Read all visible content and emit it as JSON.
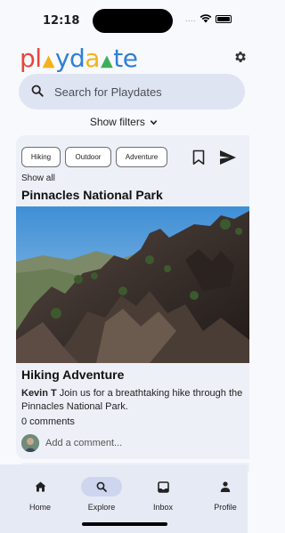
{
  "status": {
    "time": "12:18",
    "signal": "...."
  },
  "app": {
    "logo_letters": [
      {
        "char": "p",
        "color": "#e8453c"
      },
      {
        "char": "l",
        "color": "#e8453c"
      },
      {
        "char": "▲",
        "color": "#f2b21b"
      },
      {
        "char": "y",
        "color": "#2f7fd8"
      },
      {
        "char": "d",
        "color": "#2f7fd8"
      },
      {
        "char": "a",
        "color": "#f2b21b"
      },
      {
        "char": "▲",
        "color": "#3fae5a"
      },
      {
        "char": "t",
        "color": "#2f7fd8"
      },
      {
        "char": "e",
        "color": "#2f7fd8"
      }
    ],
    "settings_icon": "gear-icon"
  },
  "search": {
    "placeholder": "Search for Playdates"
  },
  "filters": {
    "label": "Show filters"
  },
  "post": {
    "tags": [
      "Hiking",
      "Outdoor",
      "Adventure"
    ],
    "show_all": "Show all",
    "place": "Pinnacles National Park",
    "title": "Hiking Adventure",
    "author": "Kevin T",
    "body": " Join us for a breathtaking hike through the Pinnacles National Park.",
    "comments": "0 comments",
    "add_comment_placeholder": "Add a comment..."
  },
  "nav": {
    "items": [
      {
        "label": "Home",
        "icon": "home-icon"
      },
      {
        "label": "Explore",
        "icon": "search-icon",
        "active": true
      },
      {
        "label": "Inbox",
        "icon": "inbox-icon"
      },
      {
        "label": "Profile",
        "icon": "person-icon"
      }
    ]
  }
}
